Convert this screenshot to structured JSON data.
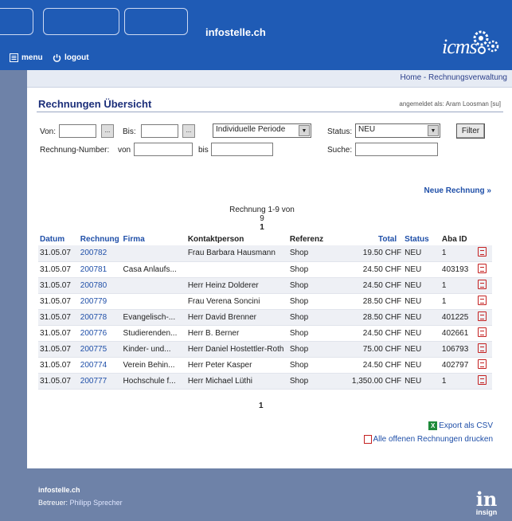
{
  "header": {
    "brand": "infostelle.ch",
    "menu_label": "menu",
    "logout_label": "logout",
    "logo_text": "icms"
  },
  "breadcrumb": {
    "home": "Home",
    "separator": " - ",
    "current": "Rechnungsverwaltung"
  },
  "page": {
    "title": "Rechnungen Übersicht",
    "logged_in": "angemeldet als: Aram Loosman [su]"
  },
  "filters": {
    "von_label": "Von:",
    "bis_label": "Bis:",
    "period_value": "Individuelle Periode",
    "status_label": "Status:",
    "status_value": "NEU",
    "filter_button": "Filter",
    "number_label": "Rechnung-Number:",
    "number_von": "von",
    "number_bis": "bis",
    "suche_label": "Suche:",
    "date_btn": "..."
  },
  "new_invoice": "Neue Rechnung »",
  "paging": {
    "summary": "Rechnung 1-9 von 9",
    "page": "1"
  },
  "table": {
    "headers": [
      "Datum",
      "Rechnung",
      "Firma",
      "Kontaktperson",
      "Referenz",
      "Total",
      "Status",
      "Aba ID"
    ],
    "rows": [
      {
        "datum": "31.05.07",
        "nr": "200782",
        "firma": "",
        "kontakt": "Frau Barbara Hausmann",
        "ref": "Shop",
        "total": "19.50 CHF",
        "status": "NEU",
        "aba": "1"
      },
      {
        "datum": "31.05.07",
        "nr": "200781",
        "firma": "Casa Anlaufs...",
        "kontakt": "",
        "ref": "Shop",
        "total": "24.50 CHF",
        "status": "NEU",
        "aba": "403193"
      },
      {
        "datum": "31.05.07",
        "nr": "200780",
        "firma": "",
        "kontakt": "Herr Heinz Dolderer",
        "ref": "Shop",
        "total": "24.50 CHF",
        "status": "NEU",
        "aba": "1"
      },
      {
        "datum": "31.05.07",
        "nr": "200779",
        "firma": "",
        "kontakt": "Frau Verena Soncini",
        "ref": "Shop",
        "total": "28.50 CHF",
        "status": "NEU",
        "aba": "1"
      },
      {
        "datum": "31.05.07",
        "nr": "200778",
        "firma": "Evangelisch-...",
        "kontakt": "Herr David Brenner",
        "ref": "Shop",
        "total": "28.50 CHF",
        "status": "NEU",
        "aba": "401225"
      },
      {
        "datum": "31.05.07",
        "nr": "200776",
        "firma": "Studierenden...",
        "kontakt": "Herr B. Berner",
        "ref": "Shop",
        "total": "24.50 CHF",
        "status": "NEU",
        "aba": "402661"
      },
      {
        "datum": "31.05.07",
        "nr": "200775",
        "firma": "Kinder- und...",
        "kontakt": "Herr Daniel Hostettler-Roth",
        "ref": "Shop",
        "total": "75.00 CHF",
        "status": "NEU",
        "aba": "106793"
      },
      {
        "datum": "31.05.07",
        "nr": "200774",
        "firma": "Verein Behin...",
        "kontakt": "Herr Peter Kasper",
        "ref": "Shop",
        "total": "24.50 CHF",
        "status": "NEU",
        "aba": "402797"
      },
      {
        "datum": "31.05.07",
        "nr": "200777",
        "firma": "Hochschule f...",
        "kontakt": "Herr Michael Lüthi",
        "ref": "Shop",
        "total": "1,350.00 CHF",
        "status": "NEU",
        "aba": "1"
      }
    ]
  },
  "bottom_page": "1",
  "exports": {
    "csv": "Export als CSV",
    "print": "Alle offenen Rechnungen drucken"
  },
  "footer": {
    "site": "infostelle.ch",
    "betreuer_label": "Betreuer:",
    "betreuer_name": "Philipp Sprecher",
    "logo_word": "insign"
  },
  "icons": [
    "menu-icon",
    "power-icon",
    "gears-icon",
    "pdf-icon",
    "csv-icon",
    "insign-logo"
  ]
}
